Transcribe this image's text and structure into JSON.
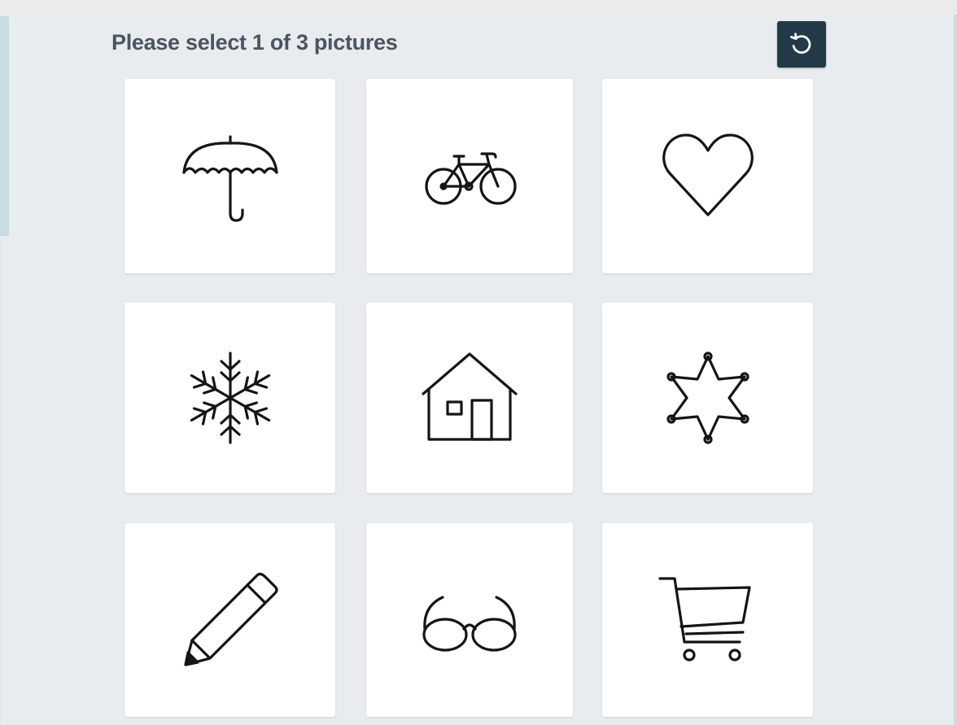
{
  "captcha": {
    "prompt": "Please select 1 of 3 pictures",
    "refresh_icon": "refresh-icon",
    "tiles": [
      {
        "icon": "umbrella-icon"
      },
      {
        "icon": "bicycle-icon"
      },
      {
        "icon": "heart-icon"
      },
      {
        "icon": "snowflake-icon"
      },
      {
        "icon": "house-icon"
      },
      {
        "icon": "sheriff-star-icon"
      },
      {
        "icon": "pencil-icon"
      },
      {
        "icon": "glasses-icon"
      },
      {
        "icon": "shopping-cart-icon"
      }
    ]
  },
  "colors": {
    "panel_background": "#e8ecef",
    "tile_background": "#ffffff",
    "refresh_button": "#233947",
    "prompt_text": "#4a5560",
    "icon_stroke": "#151515"
  }
}
